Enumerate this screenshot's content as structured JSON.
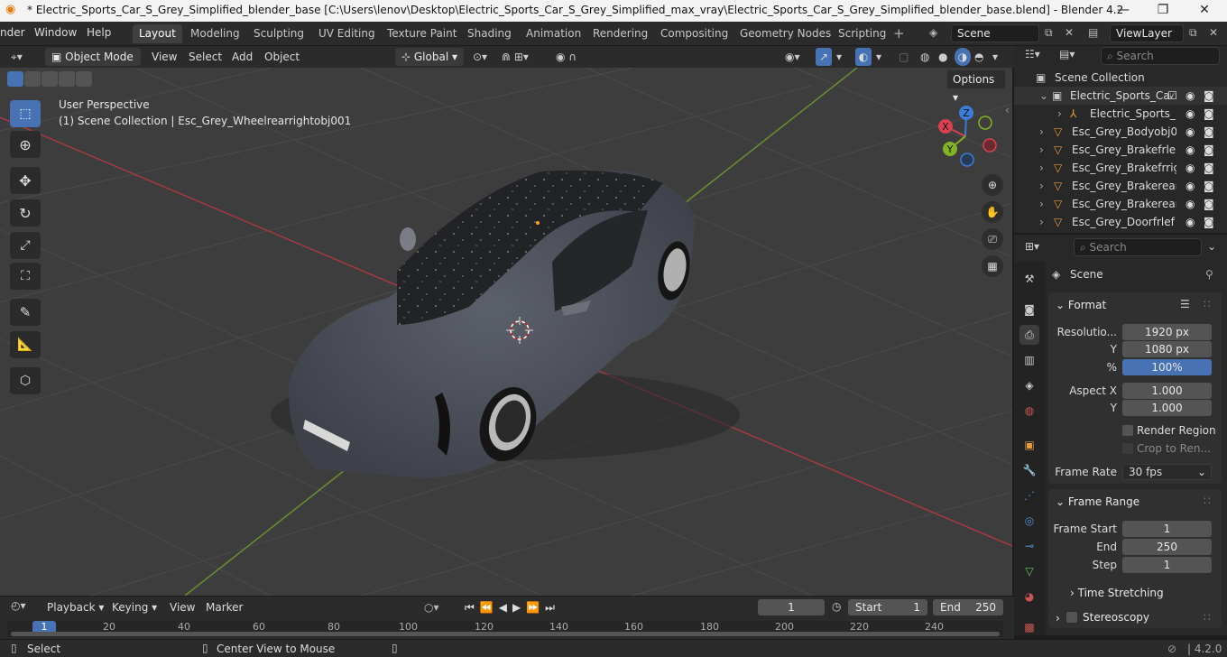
{
  "titlebar": {
    "title": "* Electric_Sports_Car_S_Grey_Simplified_blender_base [C:\\Users\\lenov\\Desktop\\Electric_Sports_Car_S_Grey_Simplified_max_vray\\Electric_Sports_Car_S_Grey_Simplified_blender_base.blend] - Blender 4.2",
    "minimize": "—",
    "maximize": "❐",
    "close": "✕"
  },
  "menus": [
    "nder",
    "Window",
    "Help"
  ],
  "workspaces": [
    "Layout",
    "Modeling",
    "Sculpting",
    "UV Editing",
    "Texture Paint",
    "Shading",
    "Animation",
    "Rendering",
    "Compositing",
    "Geometry Nodes",
    "Scripting"
  ],
  "scene": {
    "name": "Scene",
    "view_layer": "ViewLayer"
  },
  "header3d": {
    "mode": "Object Mode",
    "menus": [
      "View",
      "Select",
      "Add",
      "Object"
    ],
    "transform": "Global",
    "options": "Options"
  },
  "viewport": {
    "perspective": "User Perspective",
    "collection_info": "(1) Scene Collection | Esc_Grey_Wheelrearrightobj001",
    "gizmo": {
      "x": "X",
      "y": "Y",
      "z": "Z"
    }
  },
  "outliner": {
    "search_placeholder": "Search",
    "root": "Scene Collection",
    "items": [
      "Electric_Sports_Car",
      "Electric_Sports_",
      "Esc_Grey_Bodyobj0",
      "Esc_Grey_Brakefrle",
      "Esc_Grey_Brakefrrig",
      "Esc_Grey_Brakerear",
      "Esc_Grey_Brakerear",
      "Esc_Grey_Doorfrlef"
    ]
  },
  "properties": {
    "search_placeholder": "Search",
    "context": "Scene",
    "format": {
      "title": "Format",
      "resolution_label": "Resolutio...",
      "res_x": "1920 px",
      "y_label": "Y",
      "res_y": "1080 px",
      "pct_label": "%",
      "pct": "100%",
      "aspect_label": "Aspect X",
      "aspect_x": "1.000",
      "aspect_y_label": "Y",
      "aspect_y": "1.000",
      "render_region": "Render Region",
      "crop": "Crop to Ren...",
      "frame_rate_label": "Frame Rate",
      "frame_rate": "30 fps"
    },
    "frame_range": {
      "title": "Frame Range",
      "start_label": "Frame Start",
      "start": "1",
      "end_label": "End",
      "end": "250",
      "step_label": "Step",
      "step": "1",
      "time_stretching": "Time Stretching"
    },
    "stereoscopy": "Stereoscopy"
  },
  "timeline": {
    "menus": [
      "Playback",
      "Keying",
      "View",
      "Marker"
    ],
    "current": "1",
    "start_label": "Start",
    "start": "1",
    "end_label": "End",
    "end": "250",
    "ticks": [
      "1",
      "20",
      "40",
      "60",
      "80",
      "100",
      "120",
      "140",
      "160",
      "180",
      "200",
      "220",
      "240"
    ]
  },
  "status": {
    "select": "Select",
    "center": "Center View to Mouse",
    "version": "4.2.0"
  }
}
